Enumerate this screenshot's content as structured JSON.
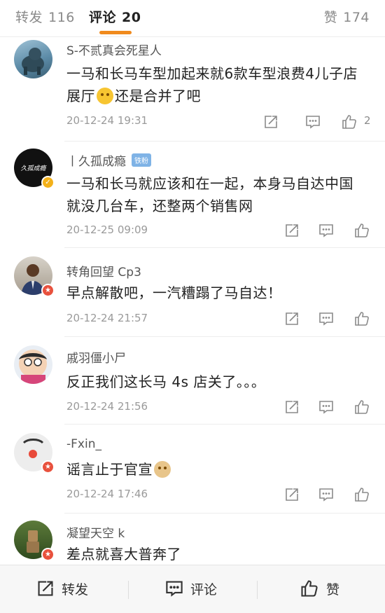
{
  "tabs": {
    "repost": {
      "label": "转发",
      "count": "116"
    },
    "comments": {
      "label": "评论",
      "count": "20"
    },
    "likes": {
      "label": "赞",
      "count": "174"
    }
  },
  "comments": [
    {
      "user": "S-不贰真会死星人",
      "text_a": "一马和长马车型加起来就6款车型浪费4儿子店展厅",
      "text_b": "还是合并了吧",
      "time": "20-12-24 19:31",
      "likes": "2"
    },
    {
      "user": "丨久孤成瘾",
      "fan_badge": "铁粉",
      "text": "一马和长马就应该和在一起，本身马自达中国就没几台车，还整两个销售网",
      "time": "20-12-25 09:09",
      "likes": ""
    },
    {
      "user": "转角回望 Cp3",
      "text": "早点解散吧，一汽糟蹋了马自达！",
      "time": "20-12-24 21:57",
      "likes": ""
    },
    {
      "user": "戚羽僵小尸",
      "text": "反正我们这长马 4s 店关了。。。",
      "time": "20-12-24 21:56",
      "likes": ""
    },
    {
      "user": "-Fxin_",
      "text": "谣言止于官宣",
      "time": "20-12-24 17:46",
      "likes": ""
    },
    {
      "user": "凝望天空 k",
      "text": "差点就喜大普奔了",
      "time": "",
      "likes": ""
    }
  ],
  "avatar2_text": "久孤成瘾",
  "bottom_bar": {
    "repost": "转发",
    "comment": "评论",
    "like": "赞"
  },
  "colors": {
    "accent": "#f08a1d",
    "badge_red": "#e8513d",
    "badge_gold": "#f3b11a"
  }
}
